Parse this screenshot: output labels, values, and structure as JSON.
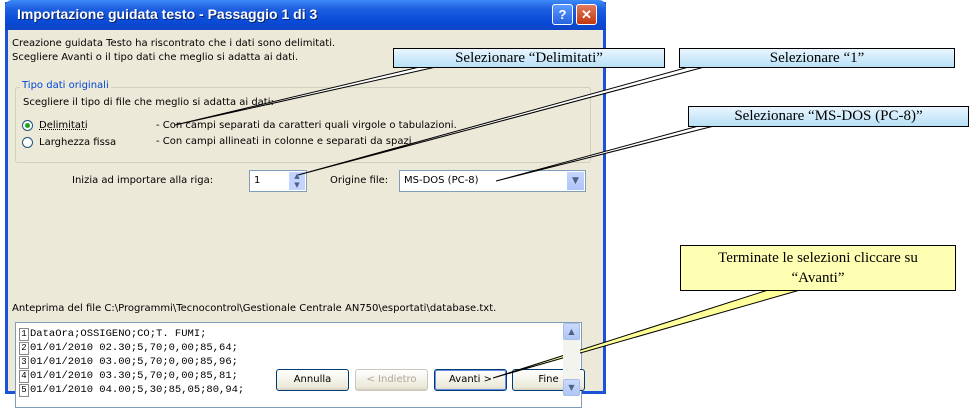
{
  "window": {
    "title": "Importazione guidata testo - Passaggio 1 di 3",
    "help_glyph": "?",
    "close_glyph": "✕"
  },
  "intro": {
    "line1": "Creazione guidata Testo ha riscontrato che i dati sono delimitati.",
    "line2": "Scegliere Avanti o il tipo dati che meglio si adatta ai dati."
  },
  "group": {
    "legend": "Tipo dati originali",
    "prompt": "Scegliere il tipo di file che meglio si adatta ai dati:",
    "options": [
      {
        "label": "Delimitati",
        "desc": "- Con campi separati da caratteri quali virgole o tabulazioni.",
        "selected": true
      },
      {
        "label": "Larghezza fissa",
        "desc": "- Con campi allineati in colonne e separati da spazi.",
        "selected": false
      }
    ]
  },
  "start_row": {
    "label": "Inizia ad importare alla riga:",
    "value": "1"
  },
  "file_origin": {
    "label": "Origine file:",
    "value": "MS-DOS (PC-8)"
  },
  "preview": {
    "label": "Anteprima del file C:\\Programmi\\Tecnocontrol\\Gestionale Centrale AN750\\esportati\\database.txt.",
    "rows": [
      {
        "n": "1",
        "text": "DataOra;OSSIGENO;CO;T. FUMI;"
      },
      {
        "n": "2",
        "text": "01/01/2010 02.30;5,70;0,00;85,64;"
      },
      {
        "n": "3",
        "text": "01/01/2010 03.00;5,70;0,00;85,96;"
      },
      {
        "n": "4",
        "text": "01/01/2010 03.30;5,70;0,00;85,81;"
      },
      {
        "n": "5",
        "text": "01/01/2010 04.00;5,30;85,05;80,94;"
      }
    ]
  },
  "buttons": {
    "cancel": "Annulla",
    "back": "< Indietro",
    "next": "Avanti >",
    "finish": "Fine"
  },
  "callouts": {
    "delimitati": "Selezionare “Delimitati”",
    "one": "Selezionare “1”",
    "msdos": "Selezionare “MS-DOS (PC-8)”",
    "avanti_line1": "Terminate le selezioni cliccare su",
    "avanti_line2": "“Avanti”"
  },
  "colors": {
    "title_bar": "#0a4bd8",
    "callout_blue": "#c9e9fb",
    "callout_yellow": "#ffffb3"
  }
}
